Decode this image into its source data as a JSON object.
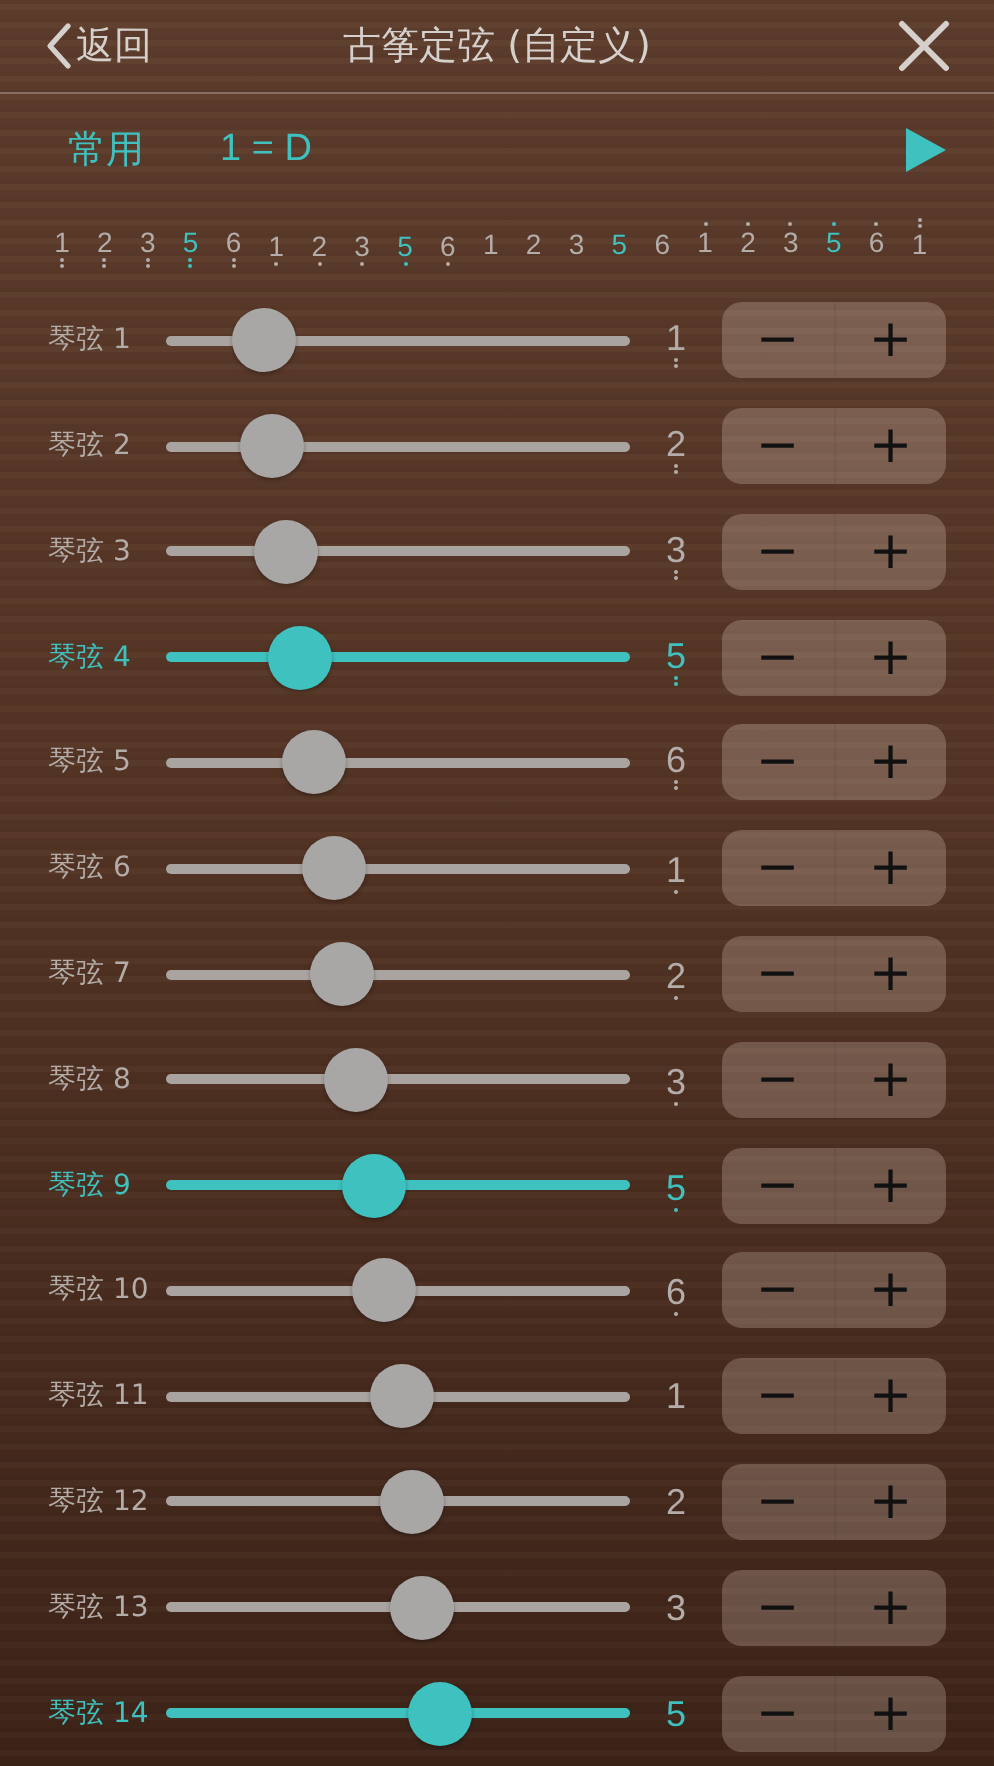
{
  "header": {
    "back": "返回",
    "title": "古筝定弦 (自定义)"
  },
  "key_bar": {
    "preset": "常用",
    "key": "1 = D"
  },
  "scale": [
    {
      "text": "1",
      "octave_down": true,
      "double": true,
      "highlighted": false
    },
    {
      "text": "2",
      "octave_down": true,
      "double": true,
      "highlighted": false
    },
    {
      "text": "3",
      "octave_down": true,
      "double": true,
      "highlighted": false
    },
    {
      "text": "5",
      "octave_down": true,
      "double": true,
      "highlighted": true
    },
    {
      "text": "6",
      "octave_down": true,
      "double": true,
      "highlighted": false
    },
    {
      "text": "1",
      "octave_down": true,
      "highlighted": false
    },
    {
      "text": "2",
      "octave_down": true,
      "highlighted": false
    },
    {
      "text": "3",
      "octave_down": true,
      "highlighted": false
    },
    {
      "text": "5",
      "octave_down": true,
      "highlighted": true
    },
    {
      "text": "6",
      "octave_down": true,
      "highlighted": false
    },
    {
      "text": "1",
      "highlighted": false
    },
    {
      "text": "2",
      "highlighted": false
    },
    {
      "text": "3",
      "highlighted": false
    },
    {
      "text": "5",
      "highlighted": true
    },
    {
      "text": "6",
      "highlighted": false
    },
    {
      "text": "1",
      "octave_up": true,
      "highlighted": false
    },
    {
      "text": "2",
      "octave_up": true,
      "highlighted": false
    },
    {
      "text": "3",
      "octave_up": true,
      "highlighted": false
    },
    {
      "text": "5",
      "octave_up": true,
      "highlighted": true
    },
    {
      "text": "6",
      "octave_up": true,
      "highlighted": false
    },
    {
      "text": "1",
      "octave_up": true,
      "double": true,
      "highlighted": false
    }
  ],
  "strings": [
    {
      "label": "琴弦 1",
      "level": 0.21,
      "note": "1",
      "octave_down": true,
      "double": true,
      "selected": false,
      "minus": "−",
      "plus": "+"
    },
    {
      "label": "琴弦 2",
      "level": 0.23,
      "note": "2",
      "octave_down": true,
      "double": true,
      "selected": false,
      "minus": "−",
      "plus": "+"
    },
    {
      "label": "琴弦 3",
      "level": 0.26,
      "note": "3",
      "octave_down": true,
      "double": true,
      "selected": false,
      "minus": "−",
      "plus": "+"
    },
    {
      "label": "琴弦 4",
      "level": 0.29,
      "note": "5",
      "octave_down": true,
      "double": true,
      "selected": true,
      "minus": "−",
      "plus": "+"
    },
    {
      "label": "琴弦 5",
      "level": 0.32,
      "note": "6",
      "octave_down": true,
      "double": true,
      "selected": false,
      "minus": "−",
      "plus": "+"
    },
    {
      "label": "琴弦 6",
      "level": 0.36,
      "note": "1",
      "octave_down": true,
      "selected": false,
      "minus": "−",
      "plus": "+"
    },
    {
      "label": "琴弦 7",
      "level": 0.38,
      "note": "2",
      "octave_down": true,
      "selected": false,
      "minus": "−",
      "plus": "+"
    },
    {
      "label": "琴弦 8",
      "level": 0.41,
      "note": "3",
      "octave_down": true,
      "selected": false,
      "minus": "−",
      "plus": "+"
    },
    {
      "label": "琴弦 9",
      "level": 0.45,
      "note": "5",
      "octave_down": true,
      "selected": true,
      "minus": "−",
      "plus": "+"
    },
    {
      "label": "琴弦 10",
      "level": 0.47,
      "note": "6",
      "octave_down": true,
      "selected": false,
      "minus": "−",
      "plus": "+"
    },
    {
      "label": "琴弦 11",
      "level": 0.51,
      "note": "1",
      "selected": false,
      "minus": "−",
      "plus": "+"
    },
    {
      "label": "琴弦 12",
      "level": 0.53,
      "note": "2",
      "selected": false,
      "minus": "−",
      "plus": "+"
    },
    {
      "label": "琴弦 13",
      "level": 0.55,
      "note": "3",
      "selected": false,
      "minus": "−",
      "plus": "+"
    },
    {
      "label": "琴弦 14",
      "level": 0.59,
      "note": "5",
      "selected": true,
      "minus": "−",
      "plus": "+"
    }
  ]
}
